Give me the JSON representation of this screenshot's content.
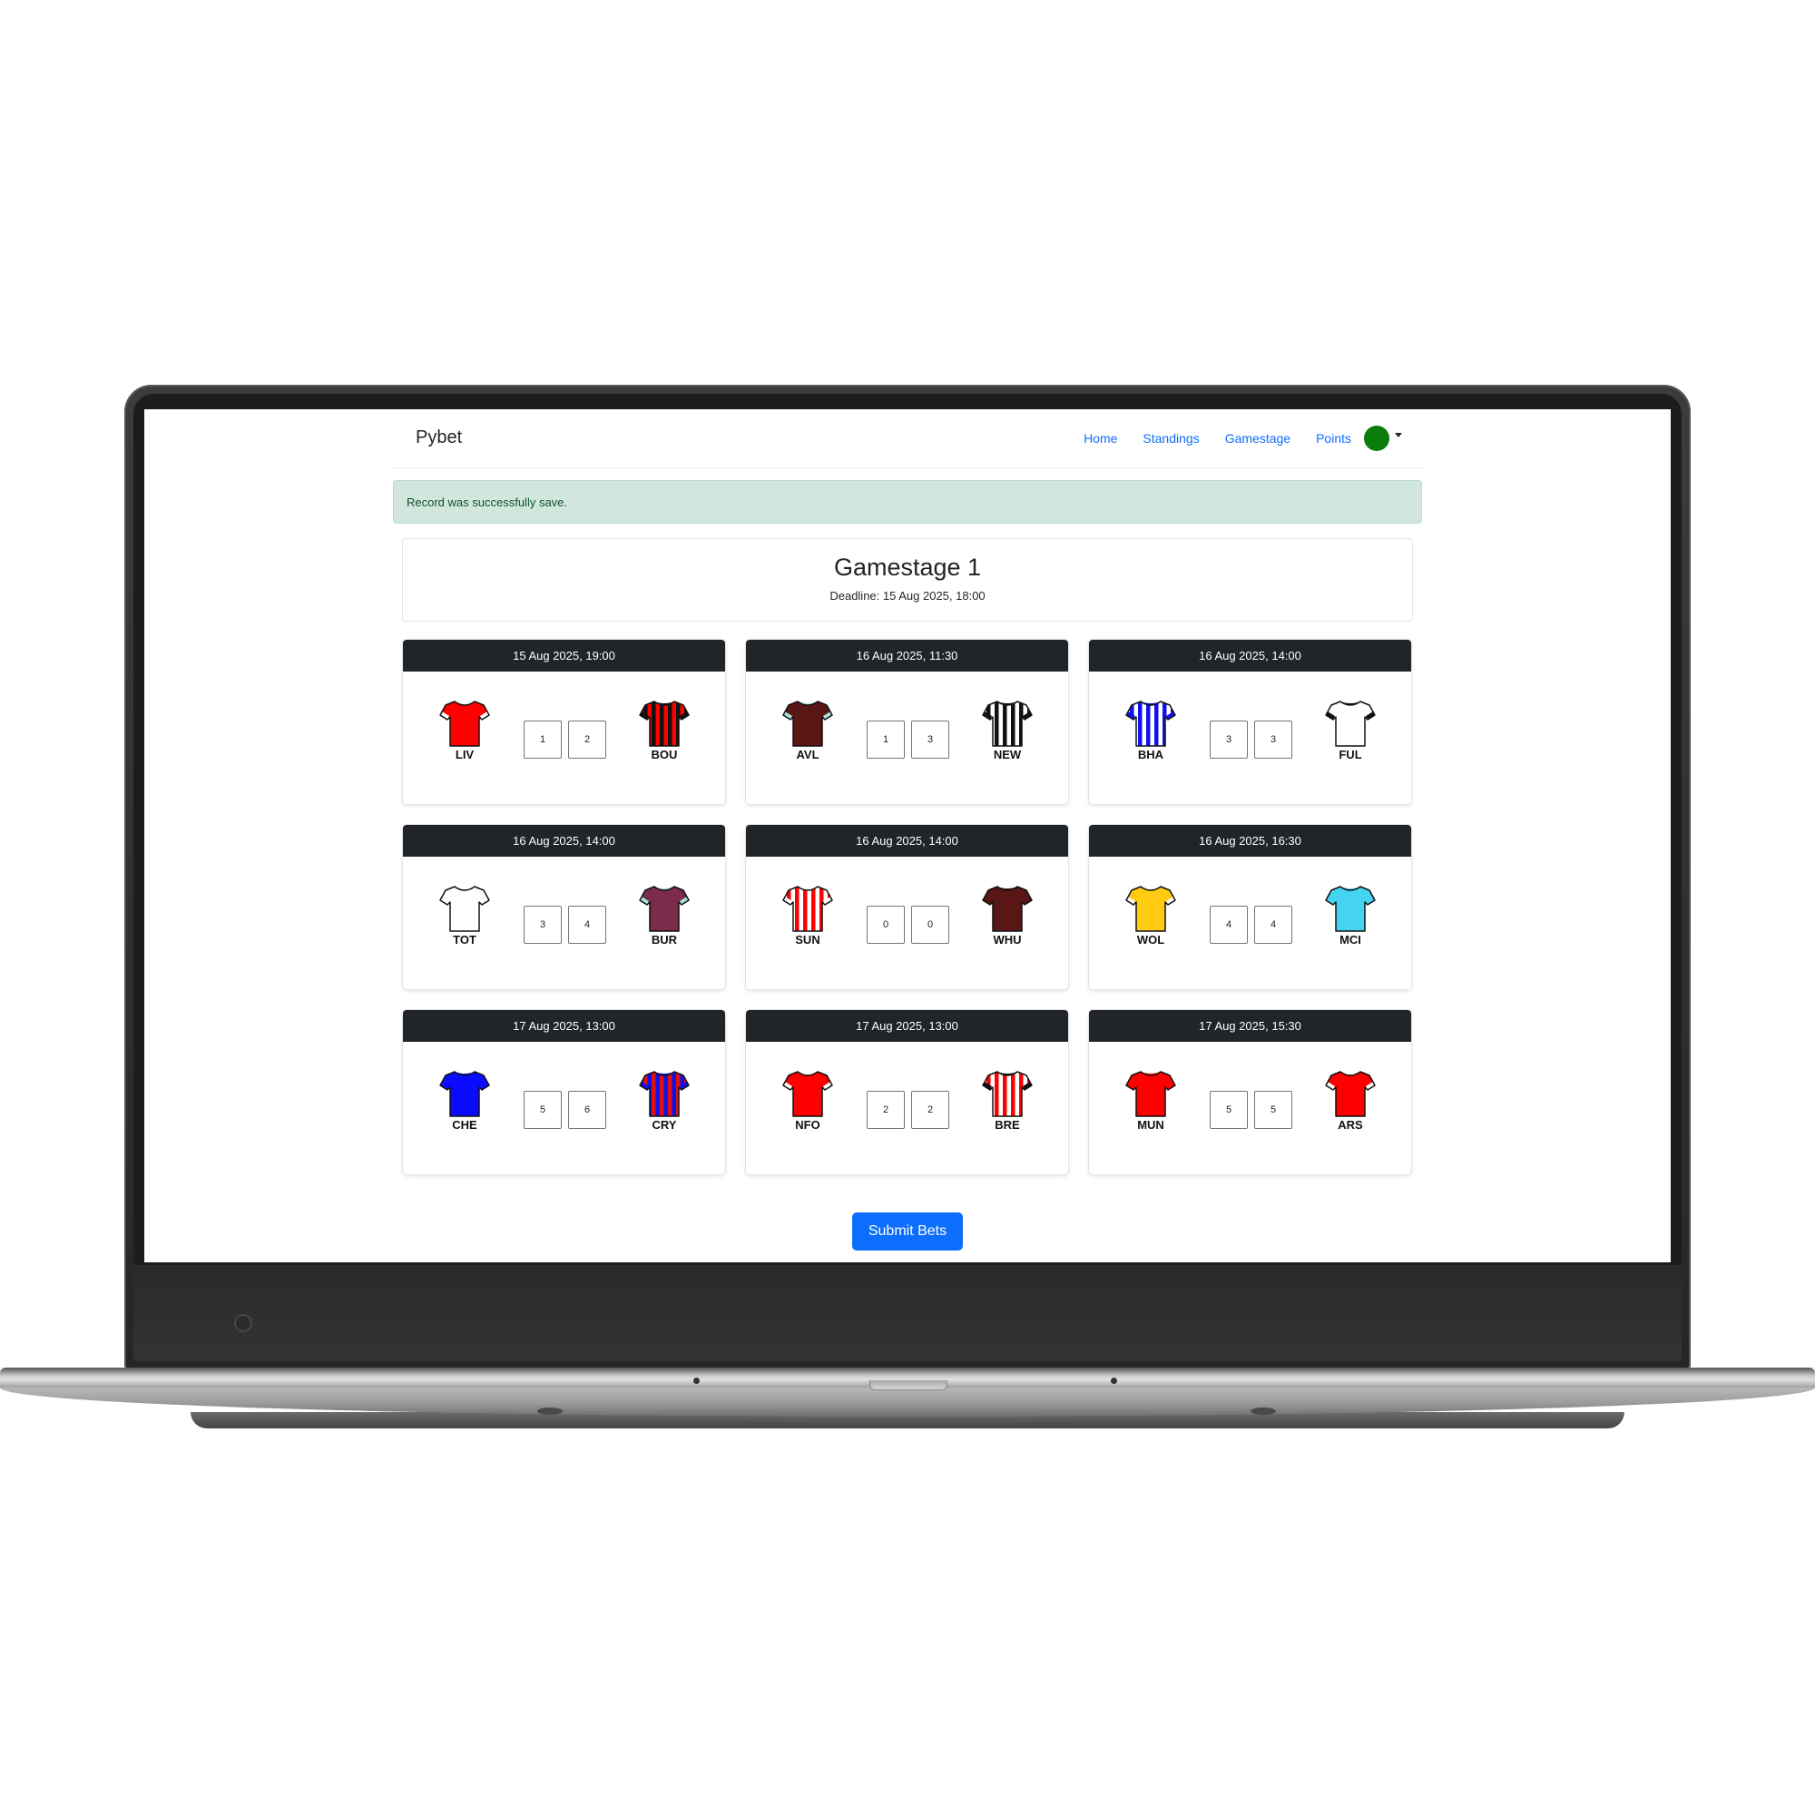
{
  "navbar": {
    "brand": "Pybet",
    "links": [
      "Home",
      "Standings",
      "Gamestage",
      "Points"
    ],
    "avatar_color": "#0a7d0a"
  },
  "alert": {
    "message": "Record was successfully save.",
    "color": "#d1e7dd"
  },
  "stage": {
    "title": "Gamestage 1",
    "deadline": "Deadline: 15 Aug 2025, 18:00"
  },
  "matches": [
    {
      "datetime": "15 Aug 2025, 19:00",
      "home": {
        "code": "LIV",
        "shirt": "solid",
        "color": "#ff0000",
        "accent": "#ff0000",
        "trim": "#ffffff"
      },
      "away": {
        "code": "BOU",
        "shirt": "stripes",
        "color": "#ff0000",
        "accent": "#111111",
        "trim": "#111111"
      },
      "home_score": "1",
      "away_score": "2"
    },
    {
      "datetime": "16 Aug 2025, 11:30",
      "home": {
        "code": "AVL",
        "shirt": "solid",
        "color": "#5a1515",
        "accent": "#5a1515",
        "trim": "#a6e3dd"
      },
      "away": {
        "code": "NEW",
        "shirt": "stripes",
        "color": "#ffffff",
        "accent": "#111111",
        "trim": "#111111"
      },
      "home_score": "1",
      "away_score": "3"
    },
    {
      "datetime": "16 Aug 2025, 14:00",
      "home": {
        "code": "BHA",
        "shirt": "stripes",
        "color": "#ffffff",
        "accent": "#1010ee",
        "trim": "#1010ee"
      },
      "away": {
        "code": "FUL",
        "shirt": "solid",
        "color": "#ffffff",
        "accent": "#ffffff",
        "trim": "#111111"
      },
      "home_score": "3",
      "away_score": "3"
    },
    {
      "datetime": "16 Aug 2025, 14:00",
      "home": {
        "code": "TOT",
        "shirt": "solid",
        "color": "#ffffff",
        "accent": "#ffffff",
        "trim": "#ffffff"
      },
      "away": {
        "code": "BUR",
        "shirt": "solid",
        "color": "#7b2b4b",
        "accent": "#7b2b4b",
        "trim": "#a6e3dd"
      },
      "home_score": "3",
      "away_score": "4"
    },
    {
      "datetime": "16 Aug 2025, 14:00",
      "home": {
        "code": "SUN",
        "shirt": "stripes",
        "color": "#ffffff",
        "accent": "#ff0000",
        "trim": "#ffffff"
      },
      "away": {
        "code": "WHU",
        "shirt": "solid",
        "color": "#5a1515",
        "accent": "#5a1515",
        "trim": "#5a1515"
      },
      "home_score": "0",
      "away_score": "0"
    },
    {
      "datetime": "16 Aug 2025, 16:30",
      "home": {
        "code": "WOL",
        "shirt": "solid",
        "color": "#ffcc11",
        "accent": "#ffcc11",
        "trim": "#ffffff"
      },
      "away": {
        "code": "MCI",
        "shirt": "solid",
        "color": "#45d3f2",
        "accent": "#45d3f2",
        "trim": "#45d3f2"
      },
      "home_score": "4",
      "away_score": "4"
    },
    {
      "datetime": "17 Aug 2025, 13:00",
      "home": {
        "code": "CHE",
        "shirt": "solid",
        "color": "#0a0aff",
        "accent": "#0a0aff",
        "trim": "#0a0aff"
      },
      "away": {
        "code": "CRY",
        "shirt": "stripes",
        "color": "#1010ee",
        "accent": "#e01010",
        "trim": "#1010ee"
      },
      "home_score": "5",
      "away_score": "6"
    },
    {
      "datetime": "17 Aug 2025, 13:00",
      "home": {
        "code": "NFO",
        "shirt": "solid",
        "color": "#ff0000",
        "accent": "#ff0000",
        "trim": "#ffffff"
      },
      "away": {
        "code": "BRE",
        "shirt": "stripes",
        "color": "#ffffff",
        "accent": "#ff0000",
        "trim": "#111111"
      },
      "home_score": "2",
      "away_score": "2"
    },
    {
      "datetime": "17 Aug 2025, 15:30",
      "home": {
        "code": "MUN",
        "shirt": "solid",
        "color": "#ff0000",
        "accent": "#ff0000",
        "trim": "#ff0000"
      },
      "away": {
        "code": "ARS",
        "shirt": "solid",
        "color": "#ff0000",
        "accent": "#ff0000",
        "trim": "#ffffff"
      },
      "home_score": "5",
      "away_score": "5"
    }
  ],
  "submit_label": "Submit Bets",
  "accent_color": "#0d6efd"
}
